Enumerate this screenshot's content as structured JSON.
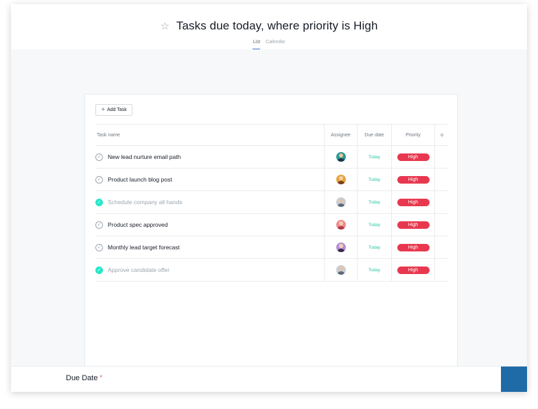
{
  "header": {
    "title": "Tasks due today, where priority is High",
    "tabs": [
      {
        "label": "List",
        "active": true
      },
      {
        "label": "Calendar",
        "active": false
      }
    ]
  },
  "toolbar": {
    "add_task_label": "Add Task"
  },
  "table": {
    "columns": [
      "Task name",
      "Assignee",
      "Due date",
      "Priority"
    ],
    "rows": [
      {
        "name": "New lead nurture email path",
        "completed": false,
        "due": "Today",
        "priority": "High"
      },
      {
        "name": "Product launch blog post",
        "completed": false,
        "due": "Today",
        "priority": "High"
      },
      {
        "name": "Schedule company all hands",
        "completed": true,
        "due": "Today",
        "priority": "High"
      },
      {
        "name": "Product spec approved",
        "completed": false,
        "due": "Today",
        "priority": "High"
      },
      {
        "name": "Monthly lead target forecast",
        "completed": false,
        "due": "Today",
        "priority": "High"
      },
      {
        "name": "Approve candidate offer",
        "completed": true,
        "due": "Today",
        "priority": "High"
      }
    ]
  },
  "form": {
    "due_date_label": "Due Date",
    "required_mark": "*"
  },
  "colors": {
    "priority_high": "#e8384f",
    "completed_check": "#25e8c8",
    "due_today": "#25c8a8",
    "tab_underline": "#4573d2",
    "action_button": "#1f6ba8"
  },
  "icons": {
    "favorite": "star-icon",
    "add": "plus-icon",
    "complete": "checkmark-icon",
    "assignee": "avatar-icon"
  }
}
